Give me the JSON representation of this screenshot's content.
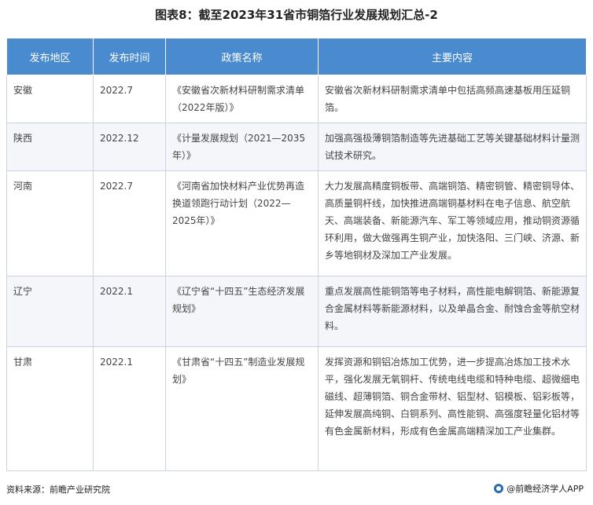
{
  "title": "图表8：截至2023年31省市铜箔行业发展规划汇总-2",
  "table": {
    "headers": [
      "发布地区",
      "发布时间",
      "政策名称",
      "主要内容"
    ],
    "rows": [
      {
        "region": "安徽",
        "date": "2022.7",
        "policy": "《安徽省次新材料研制需求清单（2022年版）》",
        "content": "安徽省次新材料研制需求清单中包括高频高速基板用压延铜箔。"
      },
      {
        "region": "陕西",
        "date": "2022.12",
        "policy": "《计量发展规划（2021—2035年）》",
        "content": "加强高强极薄铜箔制造等先进基础工艺等关键基础材料计量测试技术研究。"
      },
      {
        "region": "河南",
        "date": "2022.7",
        "policy": "《河南省加快材料产业优势再造换道领跑行动计划（2022—2025年）》",
        "content": "大力发展高精度铜板带、高端铜箔、精密铜管、精密铜导体、高质量铜杆线，加快推进高端铜基材料在电子信息、航空航天、高端装备、新能源汽车、军工等领域应用，推动铜资源循环利用，做大做强再生铜产业，加快洛阳、三门峡、济源、新乡等地铜材及深加工产业发展。"
      },
      {
        "region": "辽宁",
        "date": "2022.1",
        "policy": "《辽宁省“十四五”生态经济发展规划》",
        "content": "重点发展高性能铜箔等电子材料，高性能电解铜箔、新能源复合金属材料等新能源材料，以及单晶合金、耐蚀合金等航空材料。"
      },
      {
        "region": "甘肃",
        "date": "2022.1",
        "policy": "《甘肃省“十四五”制造业发展规划》",
        "content": "发挥资源和铜铝冶炼加工优势，进一步提高冶炼加工技术水平，强化发展无氧铜杆、传统电线电缆和特种电缆、超微细电磁线、超薄铜箔、铜合金带材、铝型材、铝模板、铝彩板等，延伸发展高纯铜、白铜系列、高性能铜、高强度轻量化铝材等有色金属新材料，形成有色金属高端精深加工产业集群。"
      }
    ]
  },
  "footer": {
    "source": "资料来源：前瞻产业研究院",
    "brand": "@前瞻经济学人APP"
  }
}
